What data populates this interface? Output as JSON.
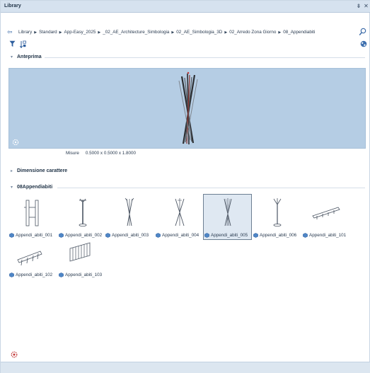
{
  "window": {
    "title": "Library",
    "pin_glyph": "⇟",
    "close_glyph": "✕"
  },
  "breadcrumb": {
    "back_glyph": "⇦",
    "items": [
      "Library",
      "Standard",
      "App-Easy_2025",
      "_02_AE_Architecture_Simbologia",
      "02_AE_Simbologia_3D",
      "02_Arredo Zona Giorno",
      "08_Appendiabiti"
    ],
    "separator": "▶"
  },
  "toolbar": {
    "icons": [
      "filter-icon",
      "sort-icon",
      "globe-icon"
    ]
  },
  "preview_section": {
    "label": "Anteprima",
    "measures_label": "Misure",
    "measures_value": "0.5000 x 0.5000 x 1.8000"
  },
  "font_section": {
    "label": "Dimensione carattere"
  },
  "items_section": {
    "label": "08Appendiabiti",
    "items": [
      {
        "label": "Appendi_abiti_001",
        "icon": "rack-panel-icon",
        "selected": false
      },
      {
        "label": "Appendi_abiti_002",
        "icon": "coat-stand-icon",
        "selected": false
      },
      {
        "label": "Appendi_abiti_003",
        "icon": "tripod-stand-icon",
        "selected": false
      },
      {
        "label": "Appendi_abiti_004",
        "icon": "tripod-stand-icon",
        "selected": false
      },
      {
        "label": "Appendi_abiti_005",
        "icon": "crossed-stand-icon",
        "selected": true
      },
      {
        "label": "Appendi_abiti_006",
        "icon": "pole-stand-icon",
        "selected": false
      },
      {
        "label": "Appendi_abiti_101",
        "icon": "wall-hook-rail-icon",
        "selected": false
      },
      {
        "label": "Appendi_abiti_102",
        "icon": "wall-hook-rail-icon",
        "selected": false
      },
      {
        "label": "Appendi_abiti_103",
        "icon": "slatted-panel-icon",
        "selected": false
      }
    ]
  },
  "colors": {
    "titlebar": "#d6e2ef",
    "preview_background": "#b5cde4",
    "selection_border": "#6d7f92",
    "statusbar": "#dce6f0"
  }
}
